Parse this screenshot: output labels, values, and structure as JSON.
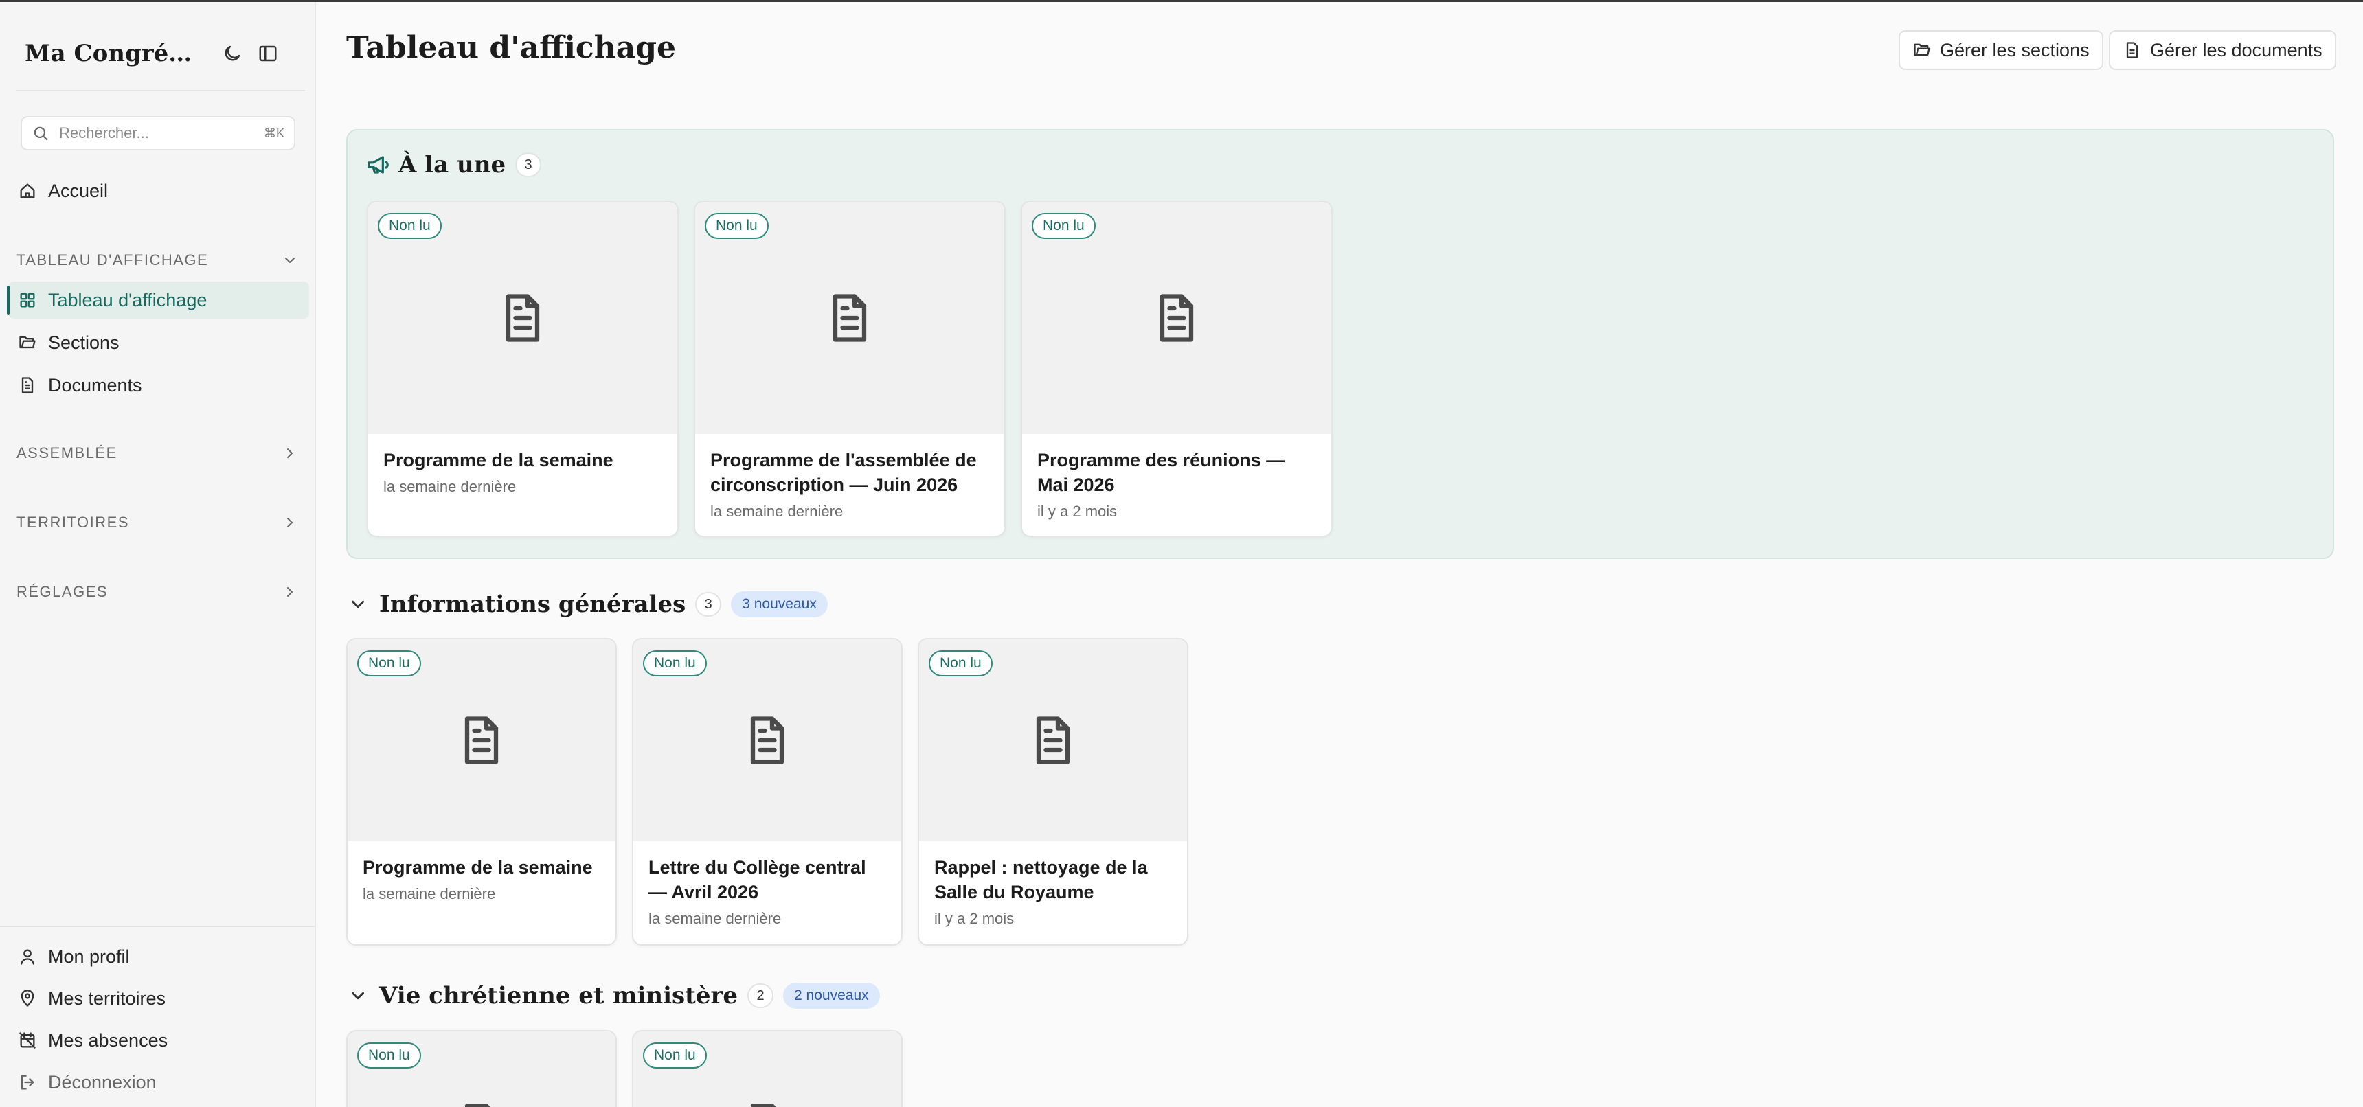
{
  "sidebar": {
    "brand": "Ma Congrégation",
    "search_placeholder": "Rechercher...",
    "search_shortcut": "⌘K",
    "home": "Accueil",
    "sections": [
      {
        "label": "TABLEAU D'AFFICHAGE",
        "expanded": true
      },
      {
        "label": "ASSEMBLÉE",
        "expanded": false
      },
      {
        "label": "TERRITOIRES",
        "expanded": false
      },
      {
        "label": "RÉGLAGES",
        "expanded": false
      }
    ],
    "board_items": [
      "Tableau d'affichage",
      "Sections",
      "Documents"
    ],
    "footer": [
      "Mon profil",
      "Mes territoires",
      "Mes absences",
      "Déconnexion"
    ]
  },
  "header": {
    "title": "Tableau d'affichage",
    "manage_sections": "Gérer les sections",
    "manage_documents": "Gérer les documents"
  },
  "featured": {
    "title": "À la une",
    "count": "3",
    "cards": [
      {
        "badge": "Non lu",
        "title": "Programme de la semaine",
        "time": "la semaine dernière"
      },
      {
        "badge": "Non lu",
        "title": "Programme de l'assemblée de circonscription — Juin 2026",
        "time": "la semaine dernière"
      },
      {
        "badge": "Non lu",
        "title": "Programme des réunions — Mai 2026",
        "time": "il y a 2 mois"
      }
    ]
  },
  "info": {
    "title": "Informations générales",
    "count": "3",
    "new": "3 nouveaux",
    "cards": [
      {
        "badge": "Non lu",
        "title": "Programme de la semaine",
        "time": "la semaine dernière"
      },
      {
        "badge": "Non lu",
        "title": "Lettre du Collège central — Avril 2026",
        "time": "la semaine dernière"
      },
      {
        "badge": "Non lu",
        "title": "Rappel : nettoyage de la Salle du Royaume",
        "time": "il y a 2 mois"
      }
    ]
  },
  "ministry": {
    "title": "Vie chrétienne et ministère",
    "count": "2",
    "new": "2 nouveaux",
    "cards": [
      {
        "badge": "Non lu"
      },
      {
        "badge": "Non lu"
      }
    ]
  },
  "colors": {
    "accent": "#17685d",
    "featured_bg": "#e9f2ef",
    "new_badge_bg": "#dce8fb"
  }
}
